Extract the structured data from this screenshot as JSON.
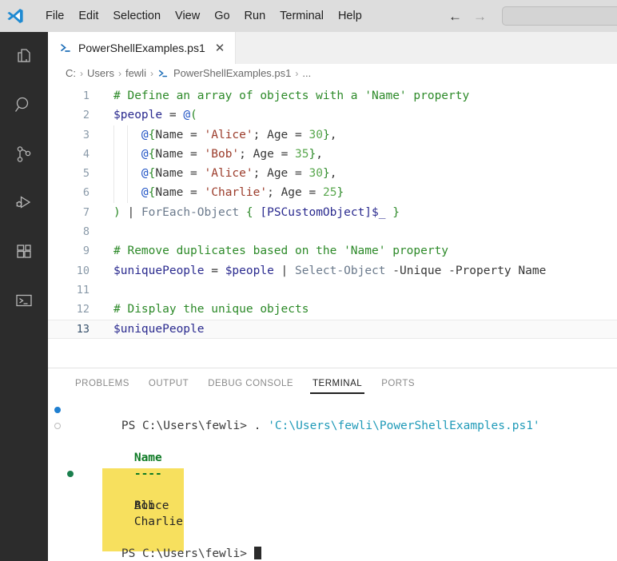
{
  "titlebar": {
    "logo_icon": "vscode-logo-icon",
    "menus": [
      "File",
      "Edit",
      "Selection",
      "View",
      "Go",
      "Run",
      "Terminal",
      "Help"
    ],
    "back_arrow": "←",
    "forward_arrow": "→",
    "command_box_value": ""
  },
  "activitybar": {
    "items": [
      {
        "name": "explorer",
        "icon": "files-icon"
      },
      {
        "name": "search",
        "icon": "search-icon"
      },
      {
        "name": "source-control",
        "icon": "source-control-icon"
      },
      {
        "name": "run-and-debug",
        "icon": "run-debug-icon"
      },
      {
        "name": "extensions",
        "icon": "extensions-icon"
      },
      {
        "name": "powershell",
        "icon": "terminal-prompt-icon"
      }
    ]
  },
  "editor": {
    "tab": {
      "label": "PowerShellExamples.ps1",
      "icon": "powershell-icon",
      "close": "✕"
    },
    "breadcrumb": {
      "separator": "›",
      "items": [
        "C:",
        "Users",
        "fewli",
        "PowerShellExamples.ps1",
        "..."
      ]
    },
    "active_line": 13,
    "lines": [
      {
        "n": "1",
        "indent": 0,
        "tokens": [
          {
            "c": "t-comment",
            "t": "# Define an array of objects with a 'Name' property"
          }
        ]
      },
      {
        "n": "2",
        "indent": 0,
        "tokens": [
          {
            "c": "t-var",
            "t": "$people"
          },
          {
            "c": "t-op",
            "t": " = "
          },
          {
            "c": "t-at",
            "t": "@"
          },
          {
            "c": "t-brace",
            "t": "("
          }
        ]
      },
      {
        "n": "3",
        "indent": 2,
        "tokens": [
          {
            "c": "t-plain",
            "t": "    "
          },
          {
            "c": "t-at",
            "t": "@"
          },
          {
            "c": "t-brace",
            "t": "{"
          },
          {
            "c": "t-plain",
            "t": "Name"
          },
          {
            "c": "t-op",
            "t": " = "
          },
          {
            "c": "t-str",
            "t": "'Alice'"
          },
          {
            "c": "t-plain",
            "t": "; "
          },
          {
            "c": "t-plain",
            "t": "Age"
          },
          {
            "c": "t-op",
            "t": " = "
          },
          {
            "c": "t-num",
            "t": "30"
          },
          {
            "c": "t-brace",
            "t": "}"
          },
          {
            "c": "t-plain",
            "t": ","
          }
        ]
      },
      {
        "n": "4",
        "indent": 2,
        "tokens": [
          {
            "c": "t-plain",
            "t": "    "
          },
          {
            "c": "t-at",
            "t": "@"
          },
          {
            "c": "t-brace",
            "t": "{"
          },
          {
            "c": "t-plain",
            "t": "Name"
          },
          {
            "c": "t-op",
            "t": " = "
          },
          {
            "c": "t-str",
            "t": "'Bob'"
          },
          {
            "c": "t-plain",
            "t": "; "
          },
          {
            "c": "t-plain",
            "t": "Age"
          },
          {
            "c": "t-op",
            "t": " = "
          },
          {
            "c": "t-num",
            "t": "35"
          },
          {
            "c": "t-brace",
            "t": "}"
          },
          {
            "c": "t-plain",
            "t": ","
          }
        ]
      },
      {
        "n": "5",
        "indent": 2,
        "tokens": [
          {
            "c": "t-plain",
            "t": "    "
          },
          {
            "c": "t-at",
            "t": "@"
          },
          {
            "c": "t-brace",
            "t": "{"
          },
          {
            "c": "t-plain",
            "t": "Name"
          },
          {
            "c": "t-op",
            "t": " = "
          },
          {
            "c": "t-str",
            "t": "'Alice'"
          },
          {
            "c": "t-plain",
            "t": "; "
          },
          {
            "c": "t-plain",
            "t": "Age"
          },
          {
            "c": "t-op",
            "t": " = "
          },
          {
            "c": "t-num",
            "t": "30"
          },
          {
            "c": "t-brace",
            "t": "}"
          },
          {
            "c": "t-plain",
            "t": ","
          }
        ]
      },
      {
        "n": "6",
        "indent": 2,
        "tokens": [
          {
            "c": "t-plain",
            "t": "    "
          },
          {
            "c": "t-at",
            "t": "@"
          },
          {
            "c": "t-brace",
            "t": "{"
          },
          {
            "c": "t-plain",
            "t": "Name"
          },
          {
            "c": "t-op",
            "t": " = "
          },
          {
            "c": "t-str",
            "t": "'Charlie'"
          },
          {
            "c": "t-plain",
            "t": "; "
          },
          {
            "c": "t-plain",
            "t": "Age"
          },
          {
            "c": "t-op",
            "t": " = "
          },
          {
            "c": "t-num",
            "t": "25"
          },
          {
            "c": "t-brace",
            "t": "}"
          }
        ]
      },
      {
        "n": "7",
        "indent": 0,
        "tokens": [
          {
            "c": "t-brace",
            "t": ")"
          },
          {
            "c": "t-plain",
            "t": " | "
          },
          {
            "c": "t-cmdlet",
            "t": "ForEach-Object"
          },
          {
            "c": "t-plain",
            "t": " "
          },
          {
            "c": "t-brace",
            "t": "{"
          },
          {
            "c": "t-plain",
            "t": " "
          },
          {
            "c": "t-type",
            "t": "[PSCustomObject]"
          },
          {
            "c": "t-var",
            "t": "$_"
          },
          {
            "c": "t-plain",
            "t": " "
          },
          {
            "c": "t-brace",
            "t": "}"
          }
        ]
      },
      {
        "n": "8",
        "indent": 0,
        "tokens": []
      },
      {
        "n": "9",
        "indent": 0,
        "tokens": [
          {
            "c": "t-comment",
            "t": "# Remove duplicates based on the 'Name' property"
          }
        ]
      },
      {
        "n": "10",
        "indent": 0,
        "tokens": [
          {
            "c": "t-var",
            "t": "$uniquePeople"
          },
          {
            "c": "t-op",
            "t": " = "
          },
          {
            "c": "t-var",
            "t": "$people"
          },
          {
            "c": "t-plain",
            "t": " | "
          },
          {
            "c": "t-cmdlet",
            "t": "Select-Object"
          },
          {
            "c": "t-plain",
            "t": " "
          },
          {
            "c": "t-param",
            "t": "-Unique"
          },
          {
            "c": "t-plain",
            "t": " "
          },
          {
            "c": "t-param",
            "t": "-Property"
          },
          {
            "c": "t-plain",
            "t": " Name"
          }
        ]
      },
      {
        "n": "11",
        "indent": 0,
        "tokens": []
      },
      {
        "n": "12",
        "indent": 0,
        "tokens": [
          {
            "c": "t-comment",
            "t": "# Display the unique objects"
          }
        ]
      },
      {
        "n": "13",
        "indent": 0,
        "tokens": [
          {
            "c": "t-var",
            "t": "$uniquePeople"
          }
        ]
      }
    ]
  },
  "panel": {
    "tabs": [
      {
        "label": "PROBLEMS",
        "active": false
      },
      {
        "label": "OUTPUT",
        "active": false
      },
      {
        "label": "DEBUG CONSOLE",
        "active": false
      },
      {
        "label": "TERMINAL",
        "active": true
      },
      {
        "label": "PORTS",
        "active": false
      }
    ],
    "terminal": {
      "prompt": "PS C:\\Users\\fewli>",
      "command_dot": ".",
      "command_path": "'C:\\Users\\fewli\\PowerShellExamples.ps1'",
      "output_header": "Name",
      "output_rule": "----",
      "output_rows": [
        "Alice",
        "Bob",
        "Charlie"
      ],
      "final_prompt": "PS C:\\Users\\fewli>",
      "cursor": "block",
      "highlight_color": "#f7e05e"
    }
  }
}
